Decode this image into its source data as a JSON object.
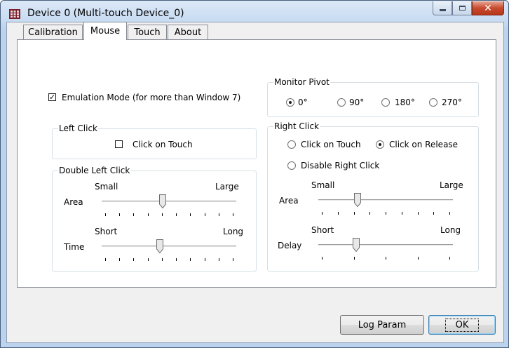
{
  "window": {
    "title": "Device 0 (Multi-touch Device_0)"
  },
  "tabs": [
    {
      "label": "Calibration",
      "active": false
    },
    {
      "label": "Mouse",
      "active": true
    },
    {
      "label": "Touch",
      "active": false
    },
    {
      "label": "About",
      "active": false
    }
  ],
  "emulation": {
    "label": "Emulation Mode (for more than Window 7)",
    "checked": true,
    "check_glyph": "✓"
  },
  "monitor_pivot": {
    "legend": "Monitor Pivot",
    "options": [
      {
        "label": "0°",
        "checked": true
      },
      {
        "label": "90°",
        "checked": false
      },
      {
        "label": "180°",
        "checked": false
      },
      {
        "label": "270°",
        "checked": false
      }
    ]
  },
  "left_click": {
    "legend": "Left Click",
    "click_on_touch": {
      "label": "Click on Touch",
      "checked": false
    }
  },
  "double_left_click": {
    "legend": "Double Left Click",
    "area": {
      "label": "Area",
      "min_label": "Small",
      "max_label": "Large",
      "value": 0.45
    },
    "time": {
      "label": "Time",
      "min_label": "Short",
      "max_label": "Long",
      "value": 0.43
    }
  },
  "right_click": {
    "legend": "Right Click",
    "options": [
      {
        "label": "Click on Touch",
        "checked": false
      },
      {
        "label": "Click on Release",
        "checked": true
      },
      {
        "label": "Disable Right Click",
        "checked": false
      }
    ],
    "area": {
      "label": "Area",
      "min_label": "Small",
      "max_label": "Large",
      "value": 0.28
    },
    "delay": {
      "label": "Delay",
      "min_label": "Short",
      "max_label": "Long",
      "value": 0.27
    }
  },
  "buttons": {
    "log_param": "Log Param",
    "ok": "OK"
  },
  "colors": {
    "title_gradient": "#bcd3ee",
    "close_button": "#c74b2f"
  }
}
